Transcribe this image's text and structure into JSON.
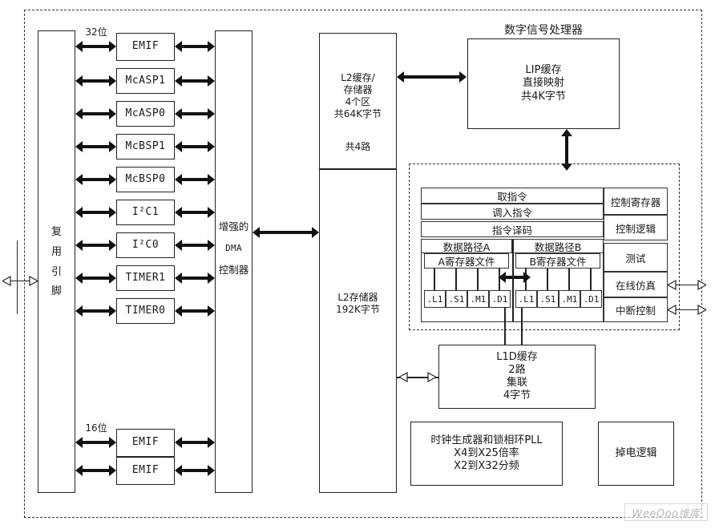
{
  "diagram": {
    "title_dsp": "数字信号处理器",
    "mux_pins_label": "复用引脚",
    "dma_label": "增强的\nDMA\n控制器",
    "bus_width_top": "32位",
    "bus_width_bottom": "16位"
  },
  "peripherals": [
    {
      "label": "EMIF"
    },
    {
      "label": "McASP1"
    },
    {
      "label": "McASP0"
    },
    {
      "label": "McBSP1"
    },
    {
      "label": "McBSP0"
    },
    {
      "label": "I²C1"
    },
    {
      "label": "I²C0"
    },
    {
      "label": "TIMER1"
    },
    {
      "label": "TIMER0"
    }
  ],
  "peripherals_bottom": [
    {
      "label": "EMIF"
    },
    {
      "label": "EMIF"
    }
  ],
  "memory": {
    "l2_cache": "L2缓存/\n存储器\n4个区\n共64K字节",
    "l2_cache_ways": "共4路",
    "l2_memory": "L2存储器\n192K字节",
    "lip_cache": "LIP缓存\n直接映射\n共4K字节",
    "l1d_cache": "L1D缓存\n2路\n集联\n4字节"
  },
  "cpu": {
    "pipeline": [
      "取指令",
      "调入指令",
      "指令译码"
    ],
    "datapaths": [
      {
        "title": "数据路径A",
        "regfile": "A寄存器文件"
      },
      {
        "title": "数据路径B",
        "regfile": "B寄存器文件"
      }
    ],
    "functional_units_a": [
      ".L1",
      ".S1",
      ".M1",
      ".D1"
    ],
    "functional_units_b": [
      ".L1",
      ".S1",
      ".M1",
      ".D1"
    ],
    "control_column": [
      "控制寄存器",
      "控制逻辑",
      "测试",
      "在线仿真",
      "中断控制"
    ]
  },
  "system": {
    "pll": "时钟生成器和锁相环PLL\nX4到X25倍率\nX2到X32分频",
    "power_down": "掉电逻辑"
  },
  "watermark": {
    "text": "WeeQoo维库"
  }
}
